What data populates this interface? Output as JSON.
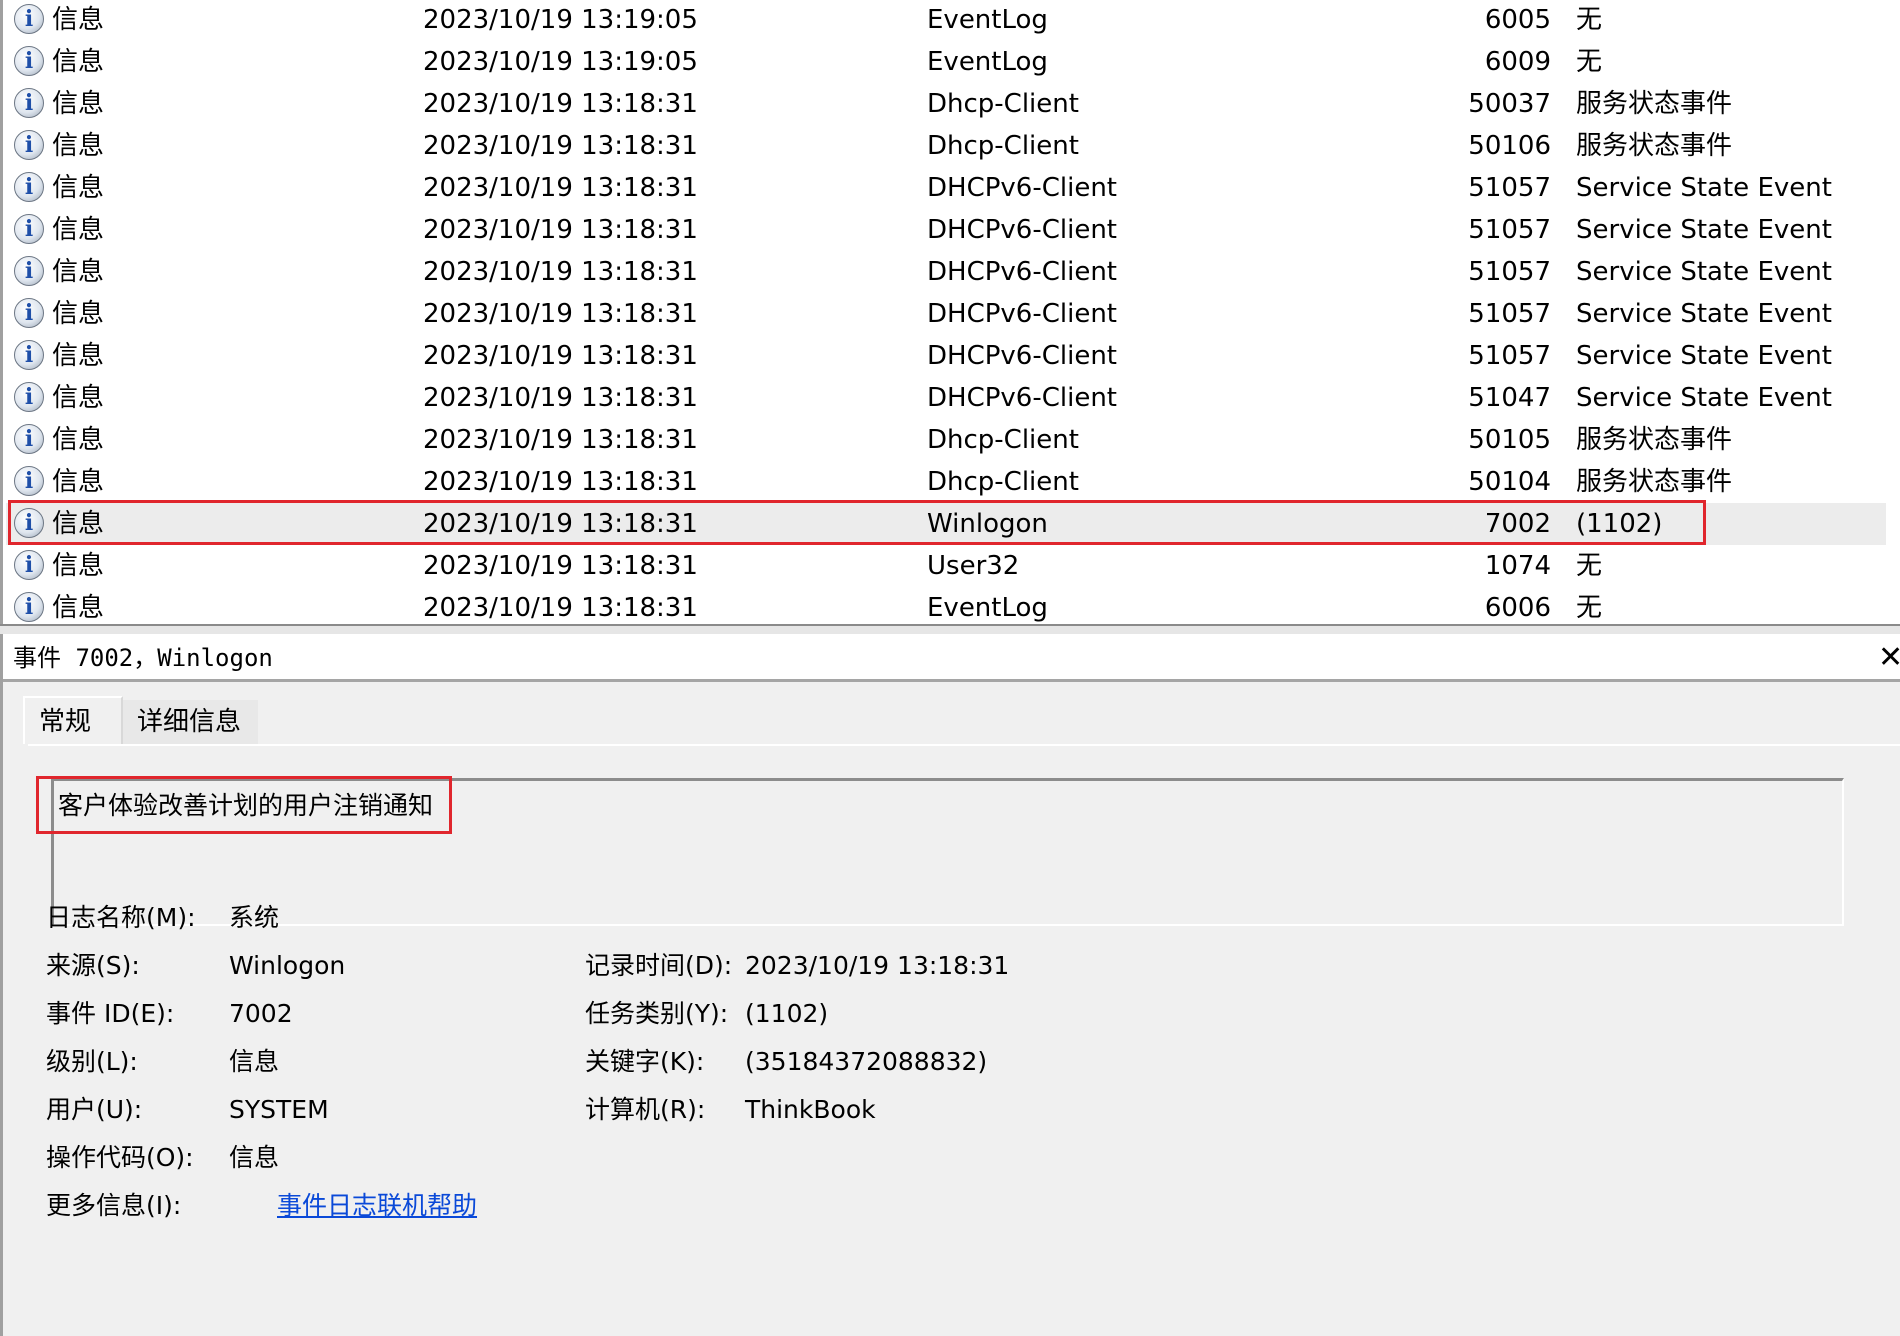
{
  "events": [
    {
      "level": "信息",
      "date": "2023/10/19 13:19:05",
      "source": "EventLog",
      "id": "6005",
      "category": "无"
    },
    {
      "level": "信息",
      "date": "2023/10/19 13:19:05",
      "source": "EventLog",
      "id": "6009",
      "category": "无"
    },
    {
      "level": "信息",
      "date": "2023/10/19 13:18:31",
      "source": "Dhcp-Client",
      "id": "50037",
      "category": "服务状态事件"
    },
    {
      "level": "信息",
      "date": "2023/10/19 13:18:31",
      "source": "Dhcp-Client",
      "id": "50106",
      "category": "服务状态事件"
    },
    {
      "level": "信息",
      "date": "2023/10/19 13:18:31",
      "source": "DHCPv6-Client",
      "id": "51057",
      "category": "Service State Event"
    },
    {
      "level": "信息",
      "date": "2023/10/19 13:18:31",
      "source": "DHCPv6-Client",
      "id": "51057",
      "category": "Service State Event"
    },
    {
      "level": "信息",
      "date": "2023/10/19 13:18:31",
      "source": "DHCPv6-Client",
      "id": "51057",
      "category": "Service State Event"
    },
    {
      "level": "信息",
      "date": "2023/10/19 13:18:31",
      "source": "DHCPv6-Client",
      "id": "51057",
      "category": "Service State Event"
    },
    {
      "level": "信息",
      "date": "2023/10/19 13:18:31",
      "source": "DHCPv6-Client",
      "id": "51057",
      "category": "Service State Event"
    },
    {
      "level": "信息",
      "date": "2023/10/19 13:18:31",
      "source": "DHCPv6-Client",
      "id": "51047",
      "category": "Service State Event"
    },
    {
      "level": "信息",
      "date": "2023/10/19 13:18:31",
      "source": "Dhcp-Client",
      "id": "50105",
      "category": "服务状态事件"
    },
    {
      "level": "信息",
      "date": "2023/10/19 13:18:31",
      "source": "Dhcp-Client",
      "id": "50104",
      "category": "服务状态事件"
    },
    {
      "level": "信息",
      "date": "2023/10/19 13:18:31",
      "source": "Winlogon",
      "id": "7002",
      "category": "(1102)",
      "selected": true
    },
    {
      "level": "信息",
      "date": "2023/10/19 13:18:31",
      "source": "User32",
      "id": "1074",
      "category": "无"
    },
    {
      "level": "信息",
      "date": "2023/10/19 13:18:31",
      "source": "EventLog",
      "id": "6006",
      "category": "无"
    }
  ],
  "icons": {
    "level_icon": "info-icon",
    "close": "close-icon"
  },
  "detail": {
    "title": "事件 7002，Winlogon",
    "close_glyph": "✕",
    "tabs": {
      "general": "常规",
      "details": "详细信息"
    },
    "description": "客户体验改善计划的用户注销通知",
    "props": {
      "log_name_label": "日志名称(M):",
      "log_name_value": "系统",
      "source_label": "来源(S):",
      "source_value": "Winlogon",
      "logged_label": "记录时间(D):",
      "logged_value": "2023/10/19 13:18:31",
      "event_id_label": "事件 ID(E):",
      "event_id_value": "7002",
      "task_category_label": "任务类别(Y):",
      "task_category_value": "(1102)",
      "level_label": "级别(L):",
      "level_value": "信息",
      "keywords_label": "关键字(K):",
      "keywords_value": "(35184372088832)",
      "user_label": "用户(U):",
      "user_value": "SYSTEM",
      "computer_label": "计算机(R):",
      "computer_value": "ThinkBook",
      "opcode_label": "操作代码(O):",
      "opcode_value": "信息",
      "more_info_label": "更多信息(I):",
      "more_info_link": "事件日志联机帮助"
    }
  },
  "colors": {
    "highlight_border": "#e0262d",
    "link": "#0a49d8",
    "pane_background": "#f0f0f0"
  }
}
